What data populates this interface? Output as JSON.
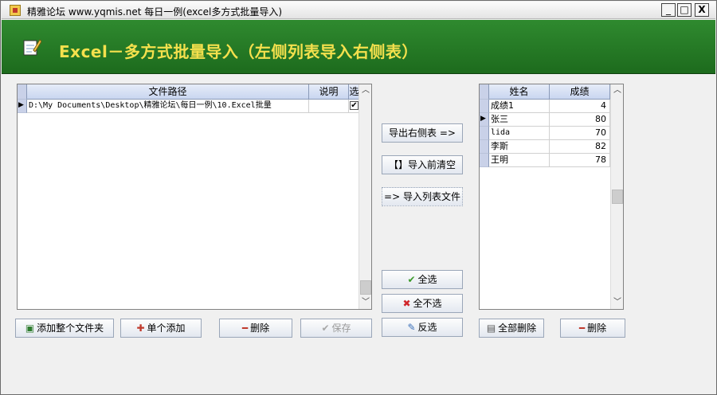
{
  "window": {
    "title": "精雅论坛  www.yqmis.net  每日一例(excel多方式批量导入)",
    "controls": {
      "minimize": "_",
      "maximize": "□",
      "close": "X"
    }
  },
  "banner": {
    "title": "Excel－多方式批量导入（左侧列表导入右侧表）"
  },
  "file_grid": {
    "columns": [
      "文件路径",
      "说明",
      "选"
    ],
    "rows": [
      {
        "path": "D:\\My Documents\\Desktop\\精雅论坛\\每日一例\\10.Excel批量",
        "note": "",
        "selected": true
      }
    ]
  },
  "score_grid": {
    "columns": [
      "姓名",
      "成绩"
    ],
    "rows": [
      {
        "name": "成绩1",
        "score": "4"
      },
      {
        "name": "张三",
        "score": "80"
      },
      {
        "name": "lida",
        "score": "70"
      },
      {
        "name": "李斯",
        "score": "82"
      },
      {
        "name": "王明",
        "score": "78"
      }
    ]
  },
  "buttons": {
    "export_right": "导出右侧表 =>",
    "clear_before_import": "【】导入前清空",
    "import_list_file": "=> 导入列表文件",
    "select_all": "全选",
    "select_none": "全不选",
    "invert": "反选",
    "add_folder": "添加整个文件夹",
    "add_single": "单个添加",
    "delete_left": "删除",
    "save": "保存",
    "delete_all": "全部删除",
    "delete_right": "删除"
  },
  "colors": {
    "banner": "#1d6b1d",
    "banner_title": "#f4e04d",
    "header": "#c9d6f0"
  }
}
